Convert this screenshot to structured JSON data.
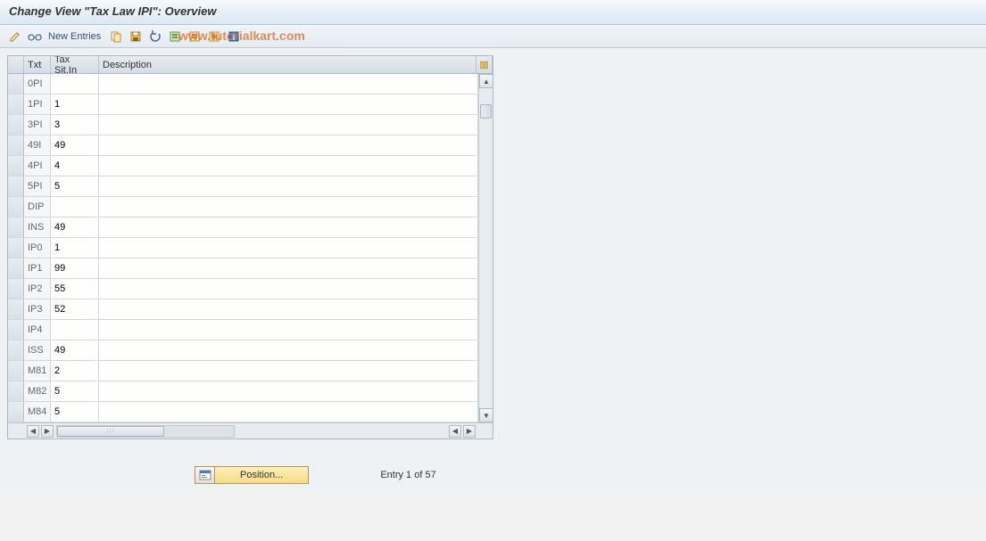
{
  "header": {
    "title": "Change View \"Tax Law IPI\": Overview"
  },
  "toolbar": {
    "new_entries_label": "New Entries"
  },
  "watermark": "www.tutorialkart.com",
  "table": {
    "columns": {
      "txt": "Txt",
      "tax_sit": "Tax Sit.In",
      "description": "Description"
    },
    "rows": [
      {
        "txt": "0PI",
        "sit": "",
        "desc": ""
      },
      {
        "txt": "1PI",
        "sit": "1",
        "desc": ""
      },
      {
        "txt": "3PI",
        "sit": "3",
        "desc": ""
      },
      {
        "txt": "49I",
        "sit": "49",
        "desc": ""
      },
      {
        "txt": "4PI",
        "sit": "4",
        "desc": ""
      },
      {
        "txt": "5PI",
        "sit": "5",
        "desc": ""
      },
      {
        "txt": "DIP",
        "sit": "",
        "desc": ""
      },
      {
        "txt": "INS",
        "sit": "49",
        "desc": ""
      },
      {
        "txt": "IP0",
        "sit": "1",
        "desc": ""
      },
      {
        "txt": "IP1",
        "sit": "99",
        "desc": ""
      },
      {
        "txt": "IP2",
        "sit": "55",
        "desc": ""
      },
      {
        "txt": "IP3",
        "sit": "52",
        "desc": ""
      },
      {
        "txt": "IP4",
        "sit": "",
        "desc": ""
      },
      {
        "txt": "ISS",
        "sit": "49",
        "desc": ""
      },
      {
        "txt": "M81",
        "sit": "2",
        "desc": ""
      },
      {
        "txt": "M82",
        "sit": "5",
        "desc": ""
      },
      {
        "txt": "M84",
        "sit": "5",
        "desc": ""
      }
    ]
  },
  "position_button": {
    "label": "Position..."
  },
  "entry_status": "Entry 1 of 57"
}
